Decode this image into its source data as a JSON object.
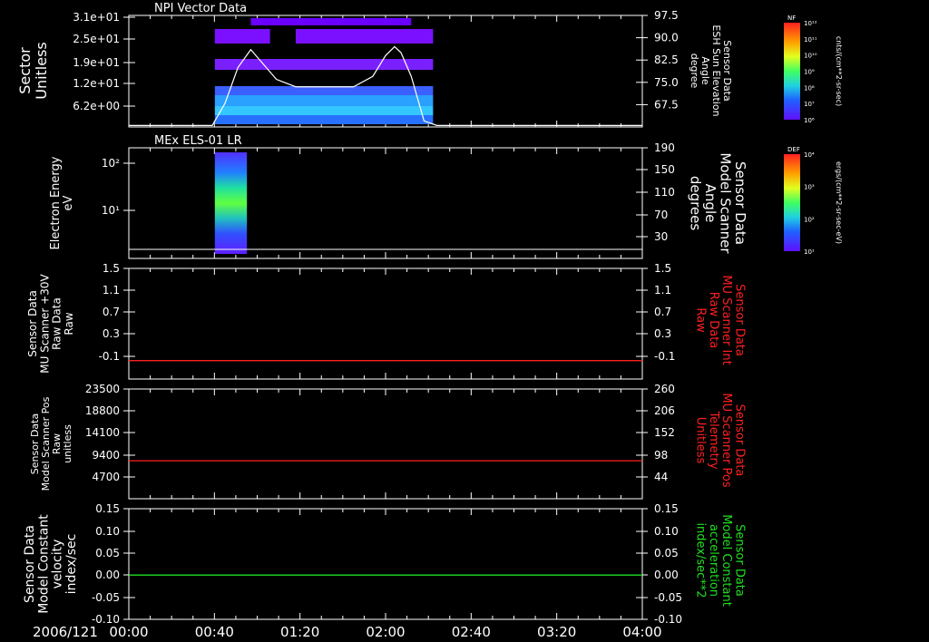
{
  "date_label": "2006/121",
  "time_ticks": [
    "00:00",
    "00:40",
    "01:20",
    "02:00",
    "02:40",
    "03:20",
    "04:00"
  ],
  "chart_data": [
    {
      "type": "heatmap",
      "title": "NPI Vector Data",
      "ylabel": [
        "Sector",
        "Unitless"
      ],
      "yticks": [
        "3.1e+01",
        "2.5e+01",
        "1.9e+01",
        "1.2e+01",
        "6.2e+00"
      ],
      "right_ylabel": [
        "Sensor Data",
        "ESH Sun Elevation",
        "Angle",
        "degree"
      ],
      "right_yticks": [
        "97.5",
        "90.0",
        "82.5",
        "75.0",
        "67.5"
      ],
      "right_ylim": [
        60,
        97.5
      ],
      "x_range_hours": [
        0,
        4
      ],
      "data_extent_hours": [
        0.67,
        2.37
      ],
      "overlay_line": {
        "name": "ESH Sun Elevation Angle",
        "x_hours": [
          0.0,
          0.65,
          0.75,
          0.85,
          0.95,
          1.05,
          1.15,
          1.3,
          1.5,
          1.75,
          1.9,
          2.0,
          2.07,
          2.12,
          2.2,
          2.3,
          2.4,
          4.0
        ],
        "y": [
          60.5,
          60.5,
          68,
          80,
          86,
          81,
          76,
          73.5,
          73.5,
          73.5,
          77,
          84,
          87,
          85,
          77,
          62,
          60.5,
          60.5
        ]
      },
      "colorbar": {
        "label": "NF",
        "units": "cnts/(cm**2-sr-sec)",
        "ticks": [
          "10¹²",
          "10¹¹",
          "10¹⁰",
          "10⁹",
          "10⁸",
          "10⁷",
          "10⁶"
        ]
      }
    },
    {
      "type": "heatmap",
      "title": "MEx ELS-01 LR",
      "ylabel": [
        "Electron Energy",
        "eV"
      ],
      "yticks": [
        "10²",
        "10¹"
      ],
      "yscale": "log",
      "right_ylabel": [
        "Sensor Data",
        "Model Scanner",
        "Angle",
        "degrees"
      ],
      "right_yticks": [
        "190",
        "150",
        "110",
        "70",
        "30"
      ],
      "right_ylim": [
        0,
        190
      ],
      "x_range_hours": [
        0,
        4
      ],
      "data_extent_hours": [
        0.67,
        0.92
      ],
      "overlay_line": {
        "name": "Model Scanner Angle",
        "x_hours": [
          0,
          4
        ],
        "y": [
          4,
          4
        ]
      },
      "colorbar": {
        "label": "DEF",
        "units": "ergs/(cm**2-sr-sec-eV)",
        "ticks": [
          "10⁴",
          "10³",
          "10²",
          "10¹"
        ]
      }
    },
    {
      "type": "line",
      "ylabel": [
        "Sensor Data",
        "MU Scanner +30V",
        "Raw Data",
        "Raw"
      ],
      "yticks": [
        "1.5",
        "1.1",
        "0.7",
        "0.3",
        "-0.1"
      ],
      "ylim": [
        -0.3,
        1.5
      ],
      "right_ylabel": [
        "Sensor Data",
        "MU Scanner Int",
        "Raw Data",
        "Raw"
      ],
      "right_yticks": [
        "1.5",
        "1.1",
        "0.7",
        "0.3",
        "-0.1"
      ],
      "right_ylim": [
        -0.3,
        1.5
      ],
      "series": [
        {
          "color": "#ff2020",
          "axis": "right",
          "x_hours": [
            0,
            4
          ],
          "values": [
            0.0,
            0.0
          ]
        }
      ]
    },
    {
      "type": "line",
      "ylabel": [
        "Sensor Data",
        "Model Scanner Pos",
        "Raw",
        "unitless"
      ],
      "yticks": [
        "23500",
        "18800",
        "14100",
        "9400",
        "4700"
      ],
      "ylim": [
        0,
        23500
      ],
      "right_ylabel": [
        "Sensor Data",
        "MU Scanner Pos",
        "Telemetry",
        "Unitless"
      ],
      "right_yticks": [
        "260",
        "206",
        "152",
        "98",
        "44"
      ],
      "right_ylim": [
        0,
        260
      ],
      "series": [
        {
          "color": "#ff2020",
          "axis": "right",
          "x_hours": [
            0,
            4
          ],
          "values": [
            90,
            90
          ]
        }
      ]
    },
    {
      "type": "line",
      "ylabel": [
        "Sensor Data",
        "Model Constant",
        "velocity",
        "index/sec"
      ],
      "yticks": [
        "0.15",
        "0.10",
        "0.05",
        "0.00",
        "-0.05",
        "-0.10"
      ],
      "ylim": [
        -0.1,
        0.15
      ],
      "right_ylabel": [
        "Sensor Data",
        "Model Constant",
        "acceleration",
        "index/sec**2"
      ],
      "right_yticks": [
        "0.15",
        "0.10",
        "0.05",
        "0.00",
        "-0.05",
        "-0.10"
      ],
      "right_ylim": [
        -0.1,
        0.15
      ],
      "series": [
        {
          "color": "#20e020",
          "axis": "left",
          "x_hours": [
            0,
            4
          ],
          "values": [
            0.0,
            0.0
          ]
        }
      ]
    }
  ],
  "colors": {
    "axis": "#ffffff",
    "background": "#000000",
    "red_label": "#ff2020",
    "green_label": "#20e020"
  }
}
